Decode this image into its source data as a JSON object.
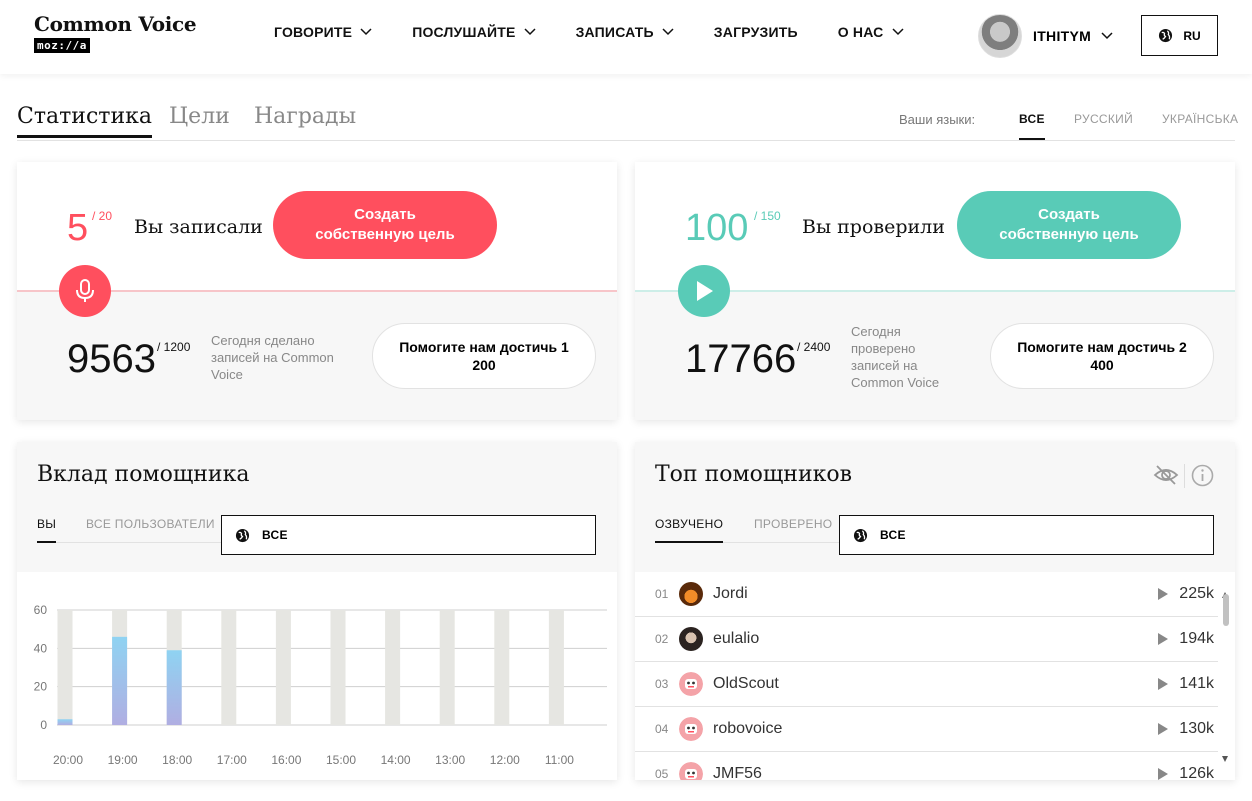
{
  "header": {
    "logo_title": "Common Voice",
    "logo_sub": "moz://a",
    "nav": [
      {
        "label": "ГОВОРИТЕ",
        "has_menu": true
      },
      {
        "label": "ПОСЛУШАЙТЕ",
        "has_menu": true
      },
      {
        "label": "ЗАПИСАТЬ",
        "has_menu": true
      },
      {
        "label": "ЗАГРУЗИТЬ",
        "has_menu": false
      },
      {
        "label": "О НАС",
        "has_menu": true
      }
    ],
    "username": "ITHITYM",
    "language_button": "RU"
  },
  "tabs": {
    "items": [
      "Статистика",
      "Цели",
      "Награды"
    ],
    "active": "Статистика",
    "languages_label": "Ваши языки:",
    "language_filters": [
      "ВСЕ",
      "РУССКИЙ",
      "УКРАЇНСЬКА"
    ],
    "active_language": "ВСЕ"
  },
  "record_card": {
    "value": "5",
    "goal": "/ 20",
    "label": "Вы записали",
    "goal_button": "Создать собственную цель",
    "today_value": "9563",
    "today_goal": "/ 1200",
    "today_text": "Сегодня сделано записей на Common Voice",
    "help_button": "Помогите нам достичь 1 200",
    "accent": "#ff4f5e",
    "icon": "microphone-icon"
  },
  "validate_card": {
    "value": "100",
    "goal": "/ 150",
    "label": "Вы проверили",
    "goal_button": "Создать собственную цель",
    "today_value": "17766",
    "today_goal": "/ 2400",
    "today_text": "Сегодня проверено записей на Common Voice",
    "help_button": "Помогите нам достичь 2 400",
    "accent": "#59cbb7",
    "icon": "play-icon"
  },
  "contribution": {
    "title": "Вклад помощника",
    "subtabs": [
      "ВЫ",
      "ВСЕ ПОЛЬЗОВАТЕЛИ"
    ],
    "active_subtab": "ВЫ",
    "select_value": "ВСЕ"
  },
  "chart_data": {
    "type": "bar",
    "categories": [
      "20:00",
      "19:00",
      "18:00",
      "17:00",
      "16:00",
      "15:00",
      "14:00",
      "13:00",
      "12:00",
      "11:00"
    ],
    "values": [
      3,
      46,
      39,
      0,
      0,
      0,
      0,
      0,
      0,
      0
    ],
    "ylim": [
      0,
      60
    ],
    "yticks": [
      0,
      20,
      40,
      60
    ],
    "grid": true,
    "bar_color_top": "#8fd3f2",
    "bar_color_bottom": "#b0aee2",
    "background_bar_color": "#e6e6e2"
  },
  "leaderboard": {
    "title": "Топ помощников",
    "subtabs": [
      "ОЗВУЧЕНО",
      "ПРОВЕРЕНО"
    ],
    "active_subtab": "ОЗВУЧЕНО",
    "select_value": "ВСЕ",
    "rows": [
      {
        "rank": "01",
        "name": "Jordi",
        "count": "225k",
        "avatar": "photo-avatar-orange"
      },
      {
        "rank": "02",
        "name": "eulalio",
        "count": "194k",
        "avatar": "photo-avatar-dark"
      },
      {
        "rank": "03",
        "name": "OldScout",
        "count": "141k",
        "avatar": "robot-avatar"
      },
      {
        "rank": "04",
        "name": "robovoice",
        "count": "130k",
        "avatar": "robot-avatar"
      },
      {
        "rank": "05",
        "name": "JMF56",
        "count": "126k",
        "avatar": "robot-avatar"
      }
    ]
  }
}
